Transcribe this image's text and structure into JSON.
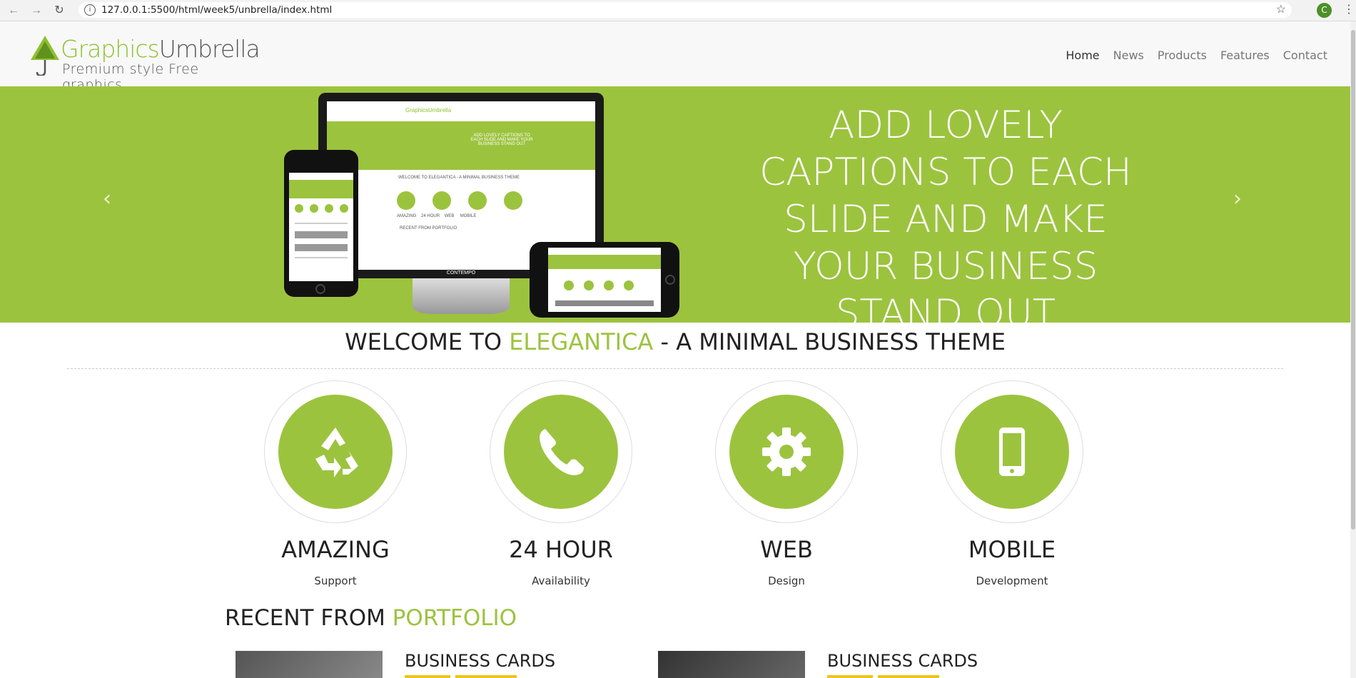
{
  "browser": {
    "url": "127.0.0.1:5500/html/week5/unbrella/index.html",
    "profile_initial": "C"
  },
  "logo": {
    "brand_part1": "Graphics",
    "brand_part2": "Umbrella",
    "tagline": "Premium style Free graphics"
  },
  "nav": {
    "items": [
      "Home",
      "News",
      "Products",
      "Features",
      "Contact"
    ]
  },
  "hero": {
    "caption": "ADD LOVELY CAPTIONS TO EACH SLIDE AND MAKE YOUR BUSINESS STAND OUT",
    "mockup": {
      "brand": "GraphicsUmbrella",
      "caption": "ADD LOVELY CAPTIONS TO EACH SLIDE AND MAKE YOUR BUSINESS STAND OUT",
      "welcome": "WELCOME TO ELEGANTICA - A MINIMAL BUSINESS THEME",
      "features": [
        "AMAZING",
        "24 HOUR",
        "WEB",
        "MOBILE"
      ],
      "recent": "RECENT FROM PORTFOLIO",
      "monitor_label": "CONTEMPO"
    }
  },
  "welcome": {
    "prefix": "WELCOME TO ",
    "accent": "ELEGANTICA",
    "suffix": " - A MINIMAL BUSINESS THEME"
  },
  "features": [
    {
      "icon": "recycle-icon",
      "title": "AMAZING",
      "subtitle": "Support"
    },
    {
      "icon": "phone-icon",
      "title": "24 HOUR",
      "subtitle": "Availability"
    },
    {
      "icon": "gear-icon",
      "title": "WEB",
      "subtitle": "Design"
    },
    {
      "icon": "mobile-icon",
      "title": "MOBILE",
      "subtitle": "Development"
    }
  ],
  "portfolio": {
    "prefix": "RECENT FROM ",
    "accent": "PORTFOLIO",
    "cards": [
      {
        "title": "BUSINESS CARDS"
      },
      {
        "title": "BUSINESS CARDS"
      }
    ]
  },
  "colors": {
    "accent": "#9cc33e",
    "tag": "#f0c419"
  }
}
